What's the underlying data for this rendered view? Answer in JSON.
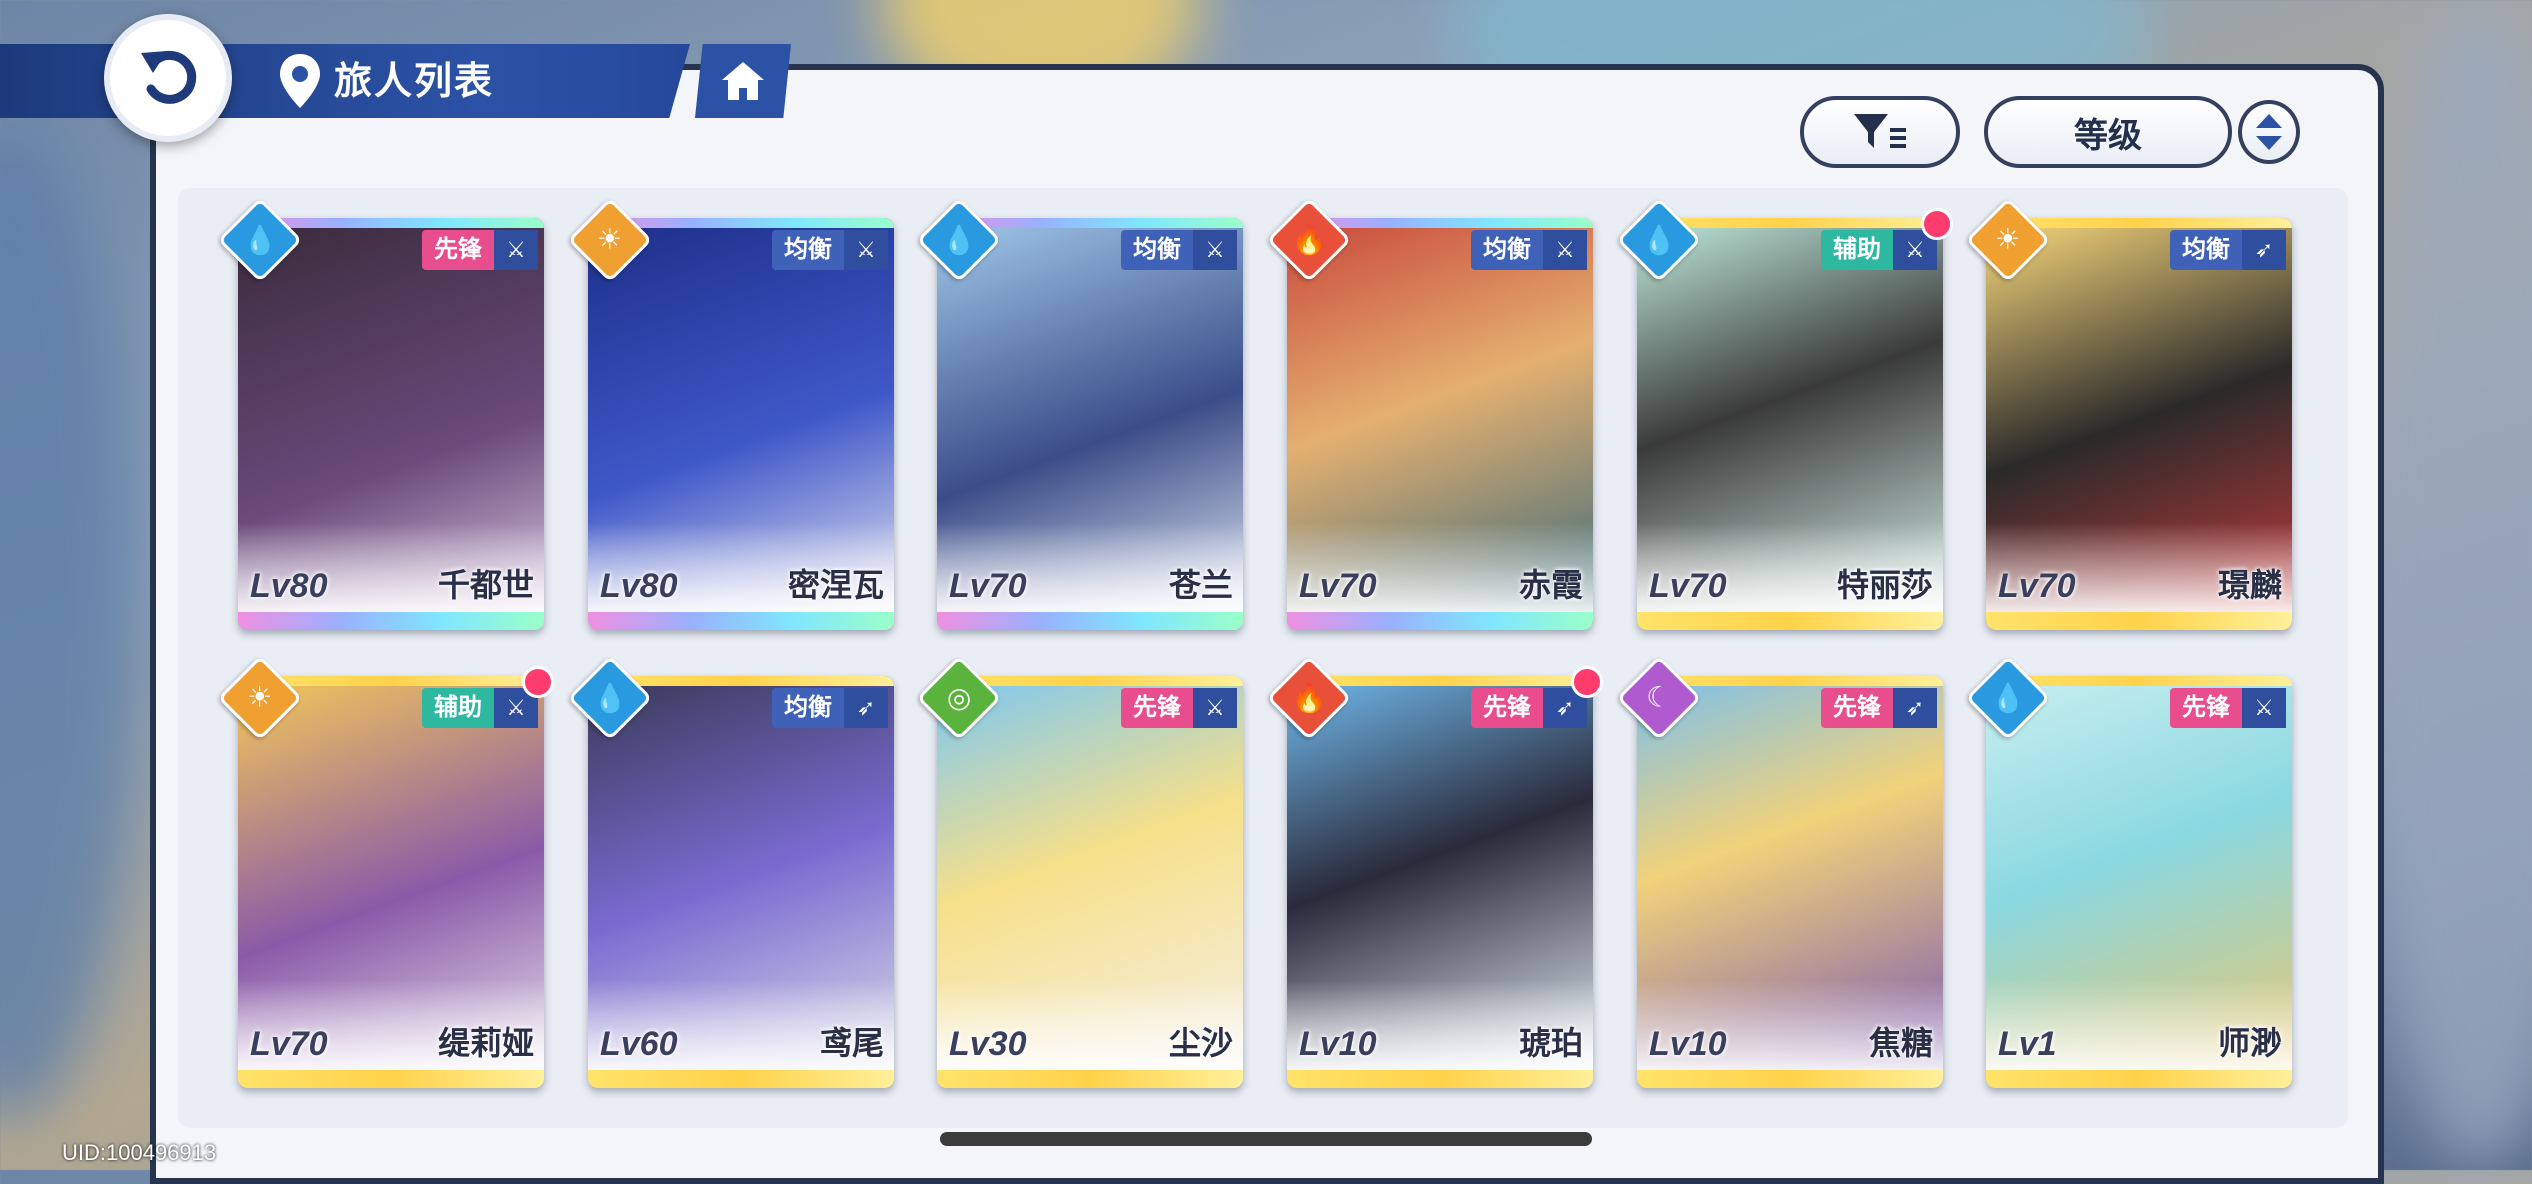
{
  "header": {
    "title": "旅人列表",
    "back_icon": "back-arrow-icon",
    "location_icon": "location-pin-icon",
    "home_icon": "home-icon"
  },
  "controls": {
    "filter_icon": "filter-icon",
    "sort_label": "等级",
    "sort_order_icon": "sort-order-icon"
  },
  "colors": {
    "header_blue": "#2c52a6",
    "panel_border": "#26344f",
    "role_vanguard": "#e84e8e",
    "role_balance": "#3f62b8",
    "role_support": "#2fb8a0",
    "red_dot": "#ff3c6e"
  },
  "characters": [
    {
      "name": "千都世",
      "level": "Lv80",
      "role": "先锋",
      "element": "water",
      "weapon": "sword",
      "rarity": "rainbow",
      "new": false
    },
    {
      "name": "密涅瓦",
      "level": "Lv80",
      "role": "均衡",
      "element": "sun",
      "weapon": "sword",
      "rarity": "rainbow",
      "new": false
    },
    {
      "name": "苍兰",
      "level": "Lv70",
      "role": "均衡",
      "element": "water",
      "weapon": "sword",
      "rarity": "rainbow",
      "new": false
    },
    {
      "name": "赤霞",
      "level": "Lv70",
      "role": "均衡",
      "element": "fire",
      "weapon": "sword",
      "rarity": "rainbow",
      "new": false
    },
    {
      "name": "特丽莎",
      "level": "Lv70",
      "role": "辅助",
      "element": "water",
      "weapon": "sword",
      "rarity": "gold",
      "new": true
    },
    {
      "name": "璟麟",
      "level": "Lv70",
      "role": "均衡",
      "element": "sun",
      "weapon": "bow",
      "rarity": "gold",
      "new": false
    },
    {
      "name": "缇莉娅",
      "level": "Lv70",
      "role": "辅助",
      "element": "sun",
      "weapon": "sword",
      "rarity": "gold",
      "new": true
    },
    {
      "name": "鸢尾",
      "level": "Lv60",
      "role": "均衡",
      "element": "water",
      "weapon": "bow",
      "rarity": "gold",
      "new": false
    },
    {
      "name": "尘沙",
      "level": "Lv30",
      "role": "先锋",
      "element": "wind",
      "weapon": "sword",
      "rarity": "gold",
      "new": false
    },
    {
      "name": "琥珀",
      "level": "Lv10",
      "role": "先锋",
      "element": "fire",
      "weapon": "bow",
      "rarity": "gold",
      "new": true
    },
    {
      "name": "焦糖",
      "level": "Lv10",
      "role": "先锋",
      "element": "moon",
      "weapon": "bow",
      "rarity": "gold",
      "new": false
    },
    {
      "name": "师渺",
      "level": "Lv1",
      "role": "先锋",
      "element": "water",
      "weapon": "sword",
      "rarity": "gold",
      "new": false
    }
  ],
  "footer": {
    "uid": "UID:100496913"
  }
}
